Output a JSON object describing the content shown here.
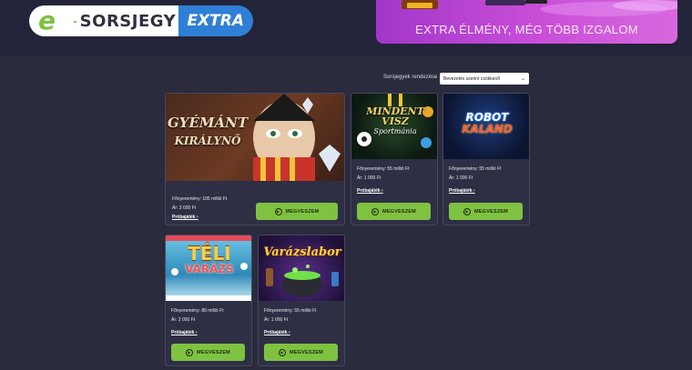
{
  "header": {
    "logo_brand": "SORSJEGY",
    "logo_extra": "EXTRA",
    "banner_text": "EXTRA ÉLMÉNY, MÉG TÖBB IZGALOM"
  },
  "sort": {
    "label": "Sorsjegyek rendezése",
    "selected": "Bevezetés szerint csökkenő"
  },
  "cards": [
    {
      "title_line1": "GYÉMÁNT",
      "title_line2": "KIRÁLYNŐ",
      "jackpot": "Főnyeremény: 105 millió Ft",
      "price": "Ár: 3 000 Ft",
      "trial": "Próbajáték ›",
      "buy": "MEGVESZEM"
    },
    {
      "title_line1": "MINDENT",
      "title_line2": "VISZ",
      "title_line3": "Sportmánia",
      "jackpot": "Főnyeremény: 55 millió Ft",
      "price": "Ár: 1 000 Ft",
      "trial": "Próbajáték ›",
      "buy": "MEGVESZEM"
    },
    {
      "title_line1": "ROBOT",
      "title_line2": "KALAND",
      "jackpot": "Főnyeremény: 55 millió Ft",
      "price": "Ár: 1 000 Ft",
      "trial": "Próbajáték ›",
      "buy": "MEGVESZEM"
    },
    {
      "title_line1": "TÉLI",
      "title_line2": "VARÁZS",
      "jackpot": "Főnyeremény: 80 millió Ft",
      "price": "Ár: 2 000 Ft",
      "trial": "Próbajáték ›",
      "buy": "MEGVESZEM"
    },
    {
      "title_line1": "Varázslabor",
      "jackpot": "Főnyeremény: 55 millió Ft",
      "price": "Ár: 1 000 Ft",
      "trial": "Próbajáték ›",
      "buy": "MEGVESZEM"
    }
  ],
  "colors": {
    "background": "#2a2b3d",
    "card": "#2e2f44",
    "buy_button": "#7fc241",
    "logo_extra": "#2f7fd6",
    "banner": "#b642d0"
  },
  "icons": [
    "play-circle-icon",
    "chevron-down-icon",
    "logo-e-icon"
  ]
}
